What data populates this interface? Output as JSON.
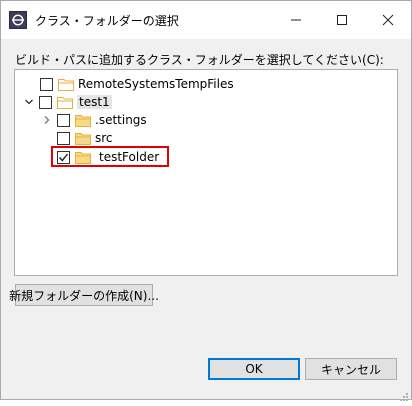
{
  "window": {
    "title": "クラス・フォルダーの選択"
  },
  "dialog": {
    "instruction": "ビルド・パスに追加するクラス・フォルダーを選択してください(C):"
  },
  "tree": {
    "items": [
      {
        "label": "RemoteSystemsTempFiles",
        "checked": false,
        "expanded": null
      },
      {
        "label": "test1",
        "checked": false,
        "expanded": true
      },
      {
        "label": ".settings",
        "checked": false,
        "expanded": false
      },
      {
        "label": "src",
        "checked": false,
        "expanded": null
      },
      {
        "label": "testFolder",
        "checked": true,
        "expanded": null
      }
    ]
  },
  "buttons": {
    "new_folder": "新規フォルダーの作成(N)...",
    "ok": "OK",
    "cancel": "キャンセル"
  },
  "colors": {
    "highlight": "#e30000",
    "folder": "#e8b23a",
    "accent": "#0078d7"
  },
  "icons": [
    "eclipse-app-icon",
    "minimize-icon",
    "maximize-icon",
    "close-icon",
    "chevron-down-icon",
    "chevron-right-icon",
    "folder-icon",
    "checkmark-icon",
    "resize-grip-icon"
  ]
}
